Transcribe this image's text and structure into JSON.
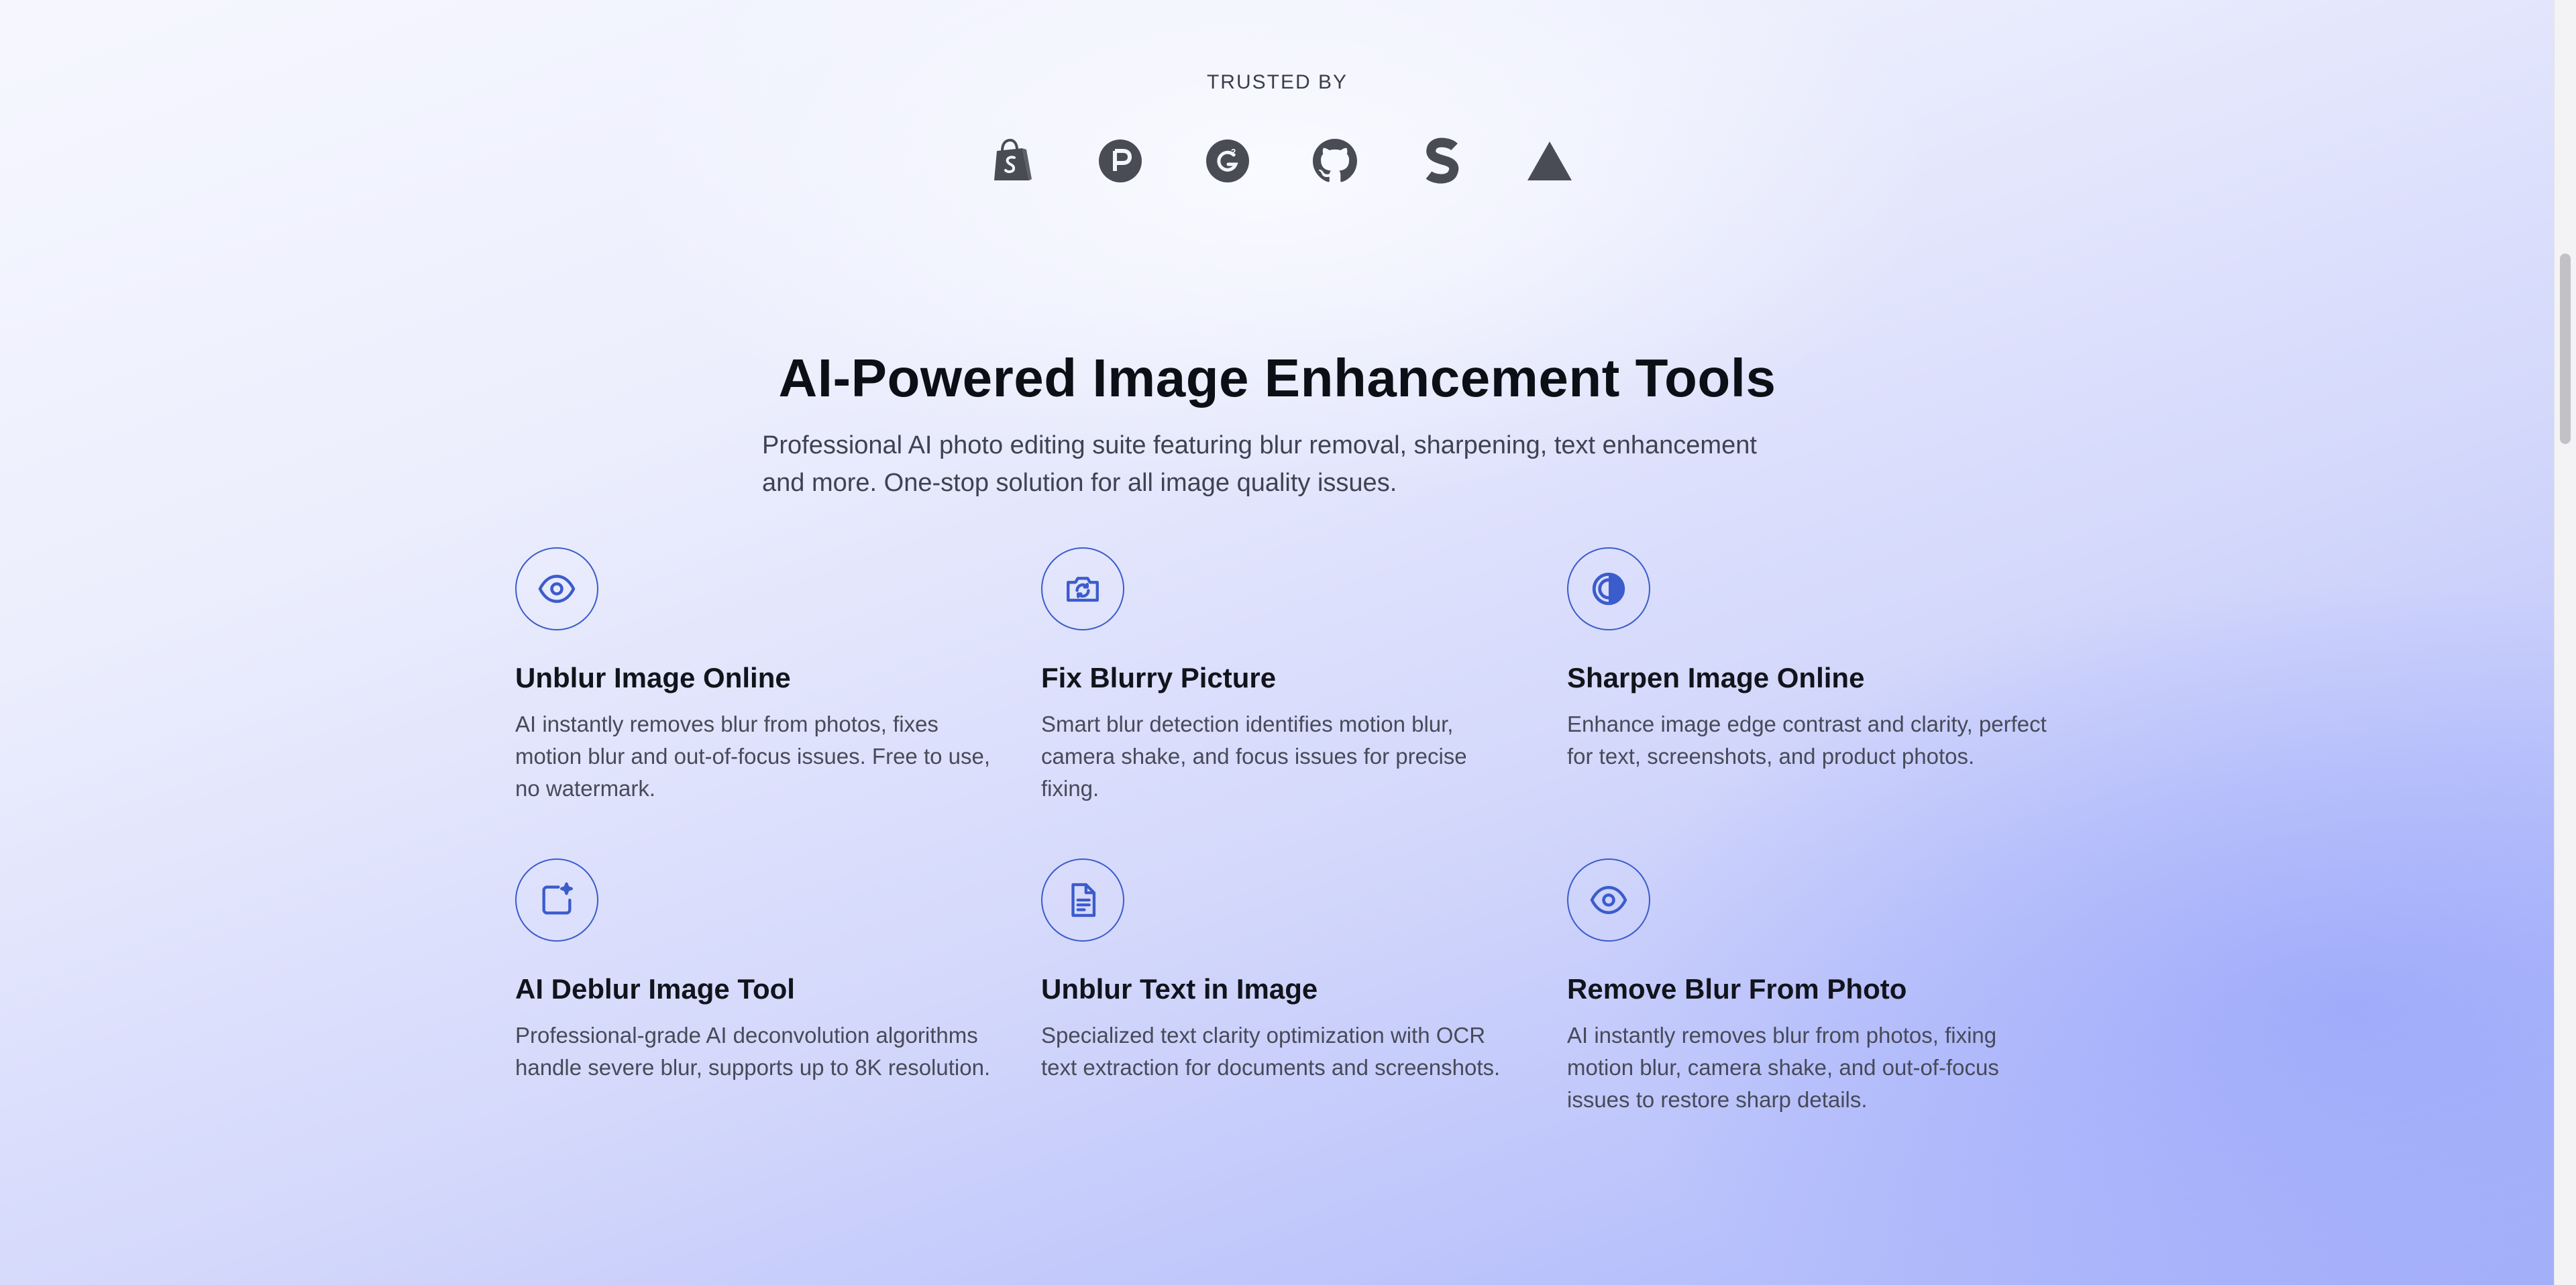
{
  "trusted": {
    "label": "TRUSTED BY",
    "logos": [
      {
        "icon": "shopify-bag-icon"
      },
      {
        "icon": "producthunt-icon"
      },
      {
        "icon": "g2-icon"
      },
      {
        "icon": "github-icon"
      },
      {
        "icon": "stripe-s-icon"
      },
      {
        "icon": "vercel-triangle-icon"
      }
    ]
  },
  "section": {
    "title": "AI-Powered Image Enhancement Tools",
    "subtitle": "Professional AI photo editing suite featuring blur removal, sharpening, text enhancement and more. One-stop solution for all image quality issues."
  },
  "features": [
    {
      "icon": "eye-icon",
      "title": "Unblur Image Online",
      "description": "AI instantly removes blur from photos, fixes motion blur and out-of-focus issues. Free to use, no watermark."
    },
    {
      "icon": "camera-rotate-icon",
      "title": "Fix Blurry Picture",
      "description": "Smart blur detection identifies motion blur, camera shake, and focus issues for precise fixing."
    },
    {
      "icon": "contrast-icon",
      "title": "Sharpen Image Online",
      "description": "Enhance image edge contrast and clarity, perfect for text, screenshots, and product photos."
    },
    {
      "icon": "image-sparkle-icon",
      "title": "AI Deblur Image Tool",
      "description": "Professional-grade AI deconvolution algorithms handle severe blur, supports up to 8K resolution."
    },
    {
      "icon": "document-text-icon",
      "title": "Unblur Text in Image",
      "description": "Specialized text clarity optimization with OCR text extraction for documents and screenshots."
    },
    {
      "icon": "eye-icon",
      "title": "Remove Blur From Photo",
      "description": "AI instantly removes blur from photos, fixing motion blur, camera shake, and out-of-focus issues to restore sharp details."
    }
  ],
  "colors": {
    "accent": "#3b5ccc",
    "heading": "#0d0f16",
    "body_text": "#474a58",
    "logo_gray": "#4a4c55"
  }
}
